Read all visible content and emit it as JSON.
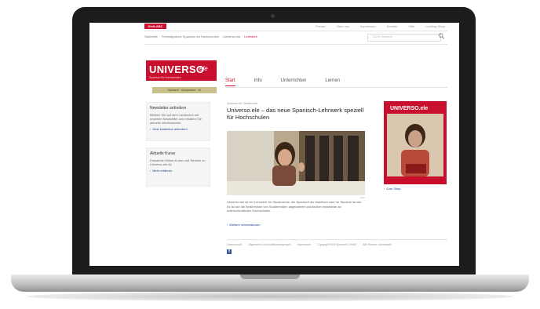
{
  "site": {
    "brand_tab": "Klett-ABC",
    "topnav": [
      "Presse",
      "Über uns",
      "Impressum",
      "Kontakt",
      "Hilfe",
      "Landing Shop"
    ],
    "breadcrumb": [
      "Startseite",
      "Fremdsprache Spanisch an Hochschulen",
      "Universo.ele",
      "Lehrwerk"
    ],
    "search_placeholder": "Suche Stichwort",
    "logo": {
      "main": "UNIVERSO",
      "ele": "ele",
      "sub": "Spanisch für Hochschulen",
      "tag": "Spanisch · Aussprache · A1"
    },
    "tabs": [
      {
        "label": "Start",
        "active": true
      },
      {
        "label": "Info",
        "active": false
      },
      {
        "label": "Unterrichten",
        "active": false
      },
      {
        "label": "Lernen",
        "active": false
      }
    ],
    "sidebar": [
      {
        "title": "Newsletter anfordern",
        "text": "Bleiben Sie auf dem Laufenden mit unserem Newsletter und erhalten Sie aktuelle Informationen.",
        "link": "Jetzt kostenlos anfordern"
      },
      {
        "title": "Aktuelle Kurse",
        "text": "Passende Online-Kurse und Termine zu Universo.ele A1",
        "link": "Mehr erfahren"
      }
    ],
    "main": {
      "kicker": "Spanisch für Studierende",
      "headline": "Universo.ele – das neue Spanisch-Lehrwerk speziell für Hochschulen",
      "caption": "Foto",
      "body": "Universo.ele ist ein Lehrwerk für Studierende, die Spanisch als Wahlfach oder im Studium lernen. Es ist auf die Bedürfnisse von Studierenden abgestimmt und flexibel einsetzbar an unterschiedlichen Hochschulen.",
      "more": "Weitere Informationen"
    },
    "book": {
      "title": "UNIVERSO.ele",
      "link": "Zum Shop"
    },
    "footer": [
      "Datenschutz",
      "Allgemeine Geschäftsbedingungen",
      "Impressum",
      "Copyright Klett Sprachen GmbH",
      "Alle Rechte vorbehalten"
    ]
  },
  "colors": {
    "brand_red": "#c8102e",
    "link_blue": "#1f3e8a"
  }
}
